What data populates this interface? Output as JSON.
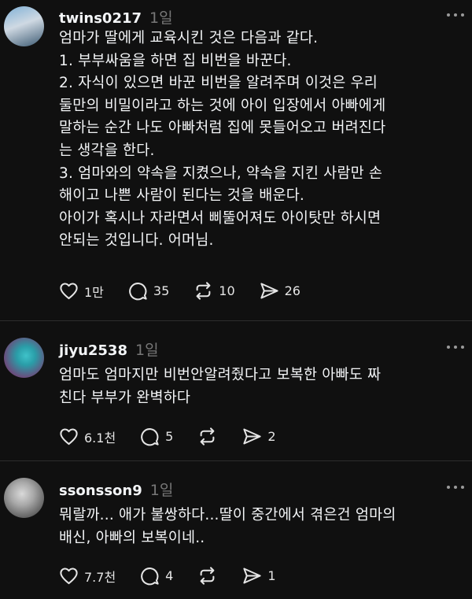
{
  "posts": [
    {
      "username": "twins0217",
      "time": "1일",
      "lines": [
        "엄마가 딸에게 교육시킨 것은 다음과 같다.",
        "1. 부부싸움을 하면 집 비번을 바꾼다.",
        "2. 자식이 있으면 바꾼 비번을 알려주며 이것은 우리",
        "둘만의 비밀이라고 하는 것에 아이 입장에서 아빠에게",
        "말하는 순간 나도 아빠처럼 집에 못들어오고 버려진다",
        "는 생각을 한다.",
        "3. 엄마와의 약속을 지켰으나, 약속을 지킨 사람만 손",
        "해이고 나쁜 사람이 된다는 것을 배운다.",
        "아이가 혹시나 자라면서 삐뚤어져도 아이탓만 하시면",
        "안되는 것입니다. 어머님."
      ],
      "likes": "1만",
      "comments": "35",
      "reposts": "10",
      "shares": "26"
    },
    {
      "username": "jiyu2538",
      "time": "1일",
      "lines": [
        "엄마도 엄마지만 비번안알려줬다고 보복한 아빠도 짜",
        "친다 부부가 완벽하다"
      ],
      "likes": "6.1천",
      "comments": "5",
      "reposts": "",
      "shares": "2"
    },
    {
      "username": "ssonsson9",
      "time": "1일",
      "lines": [
        "뭐랄까... 애가 불쌍하다...딸이 중간에서 겪은건 엄마의",
        "배신, 아빠의 보복이네.."
      ],
      "likes": "7.7천",
      "comments": "4",
      "reposts": "",
      "shares": "1"
    }
  ],
  "icons": {
    "like": "heart-icon",
    "comment": "speech-bubble-icon",
    "repost": "repost-icon",
    "share": "send-icon"
  }
}
